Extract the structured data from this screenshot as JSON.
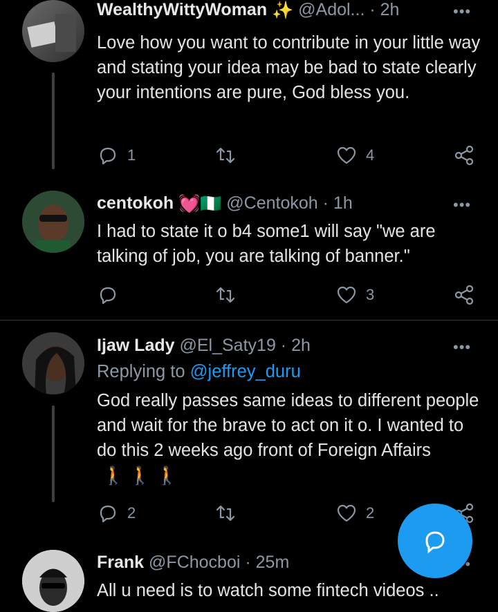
{
  "tweets": [
    {
      "name": "WealthyWittyWoman",
      "name_emoji": "✨",
      "handle": "@Adol...",
      "time": "· 2h",
      "text": "Love how you want to contribute in your little way and stating your idea may be bad to state clearly your intentions are pure, God bless you.",
      "replies": "1",
      "retweets": "",
      "likes": "4"
    },
    {
      "name": "centokoh",
      "name_emoji": "💓🇳🇬",
      "handle": "@Centokoh",
      "time": "· 1h",
      "text": "I had to state it o b4 some1 will say \"we are talking of job, you are talking of banner.\"",
      "replies": "",
      "retweets": "",
      "likes": "3"
    },
    {
      "name": "Ijaw Lady",
      "handle": "@El_Saty19",
      "time": "· 2h",
      "replying_label": "Replying to",
      "replying_handle": "@jeffrey_duru",
      "text": "God really passes same ideas to different people and wait for the brave to act on it o. I wanted to do this 2 weeks ago front of Foreign Affairs",
      "text_emoji": "🚶 🚶 🚶",
      "replies": "2",
      "retweets": "",
      "likes": "2"
    },
    {
      "name": "Frank",
      "handle": "@FChocboi",
      "time": "· 25m",
      "text": "All u need is to watch some fintech videos .."
    }
  ],
  "more_glyph": "•••",
  "colors": {
    "accent": "#1d9bf0",
    "background": "#000000",
    "muted": "#8b98a5"
  },
  "icons": [
    "reply-icon",
    "retweet-icon",
    "like-icon",
    "share-icon",
    "compose-icon"
  ]
}
